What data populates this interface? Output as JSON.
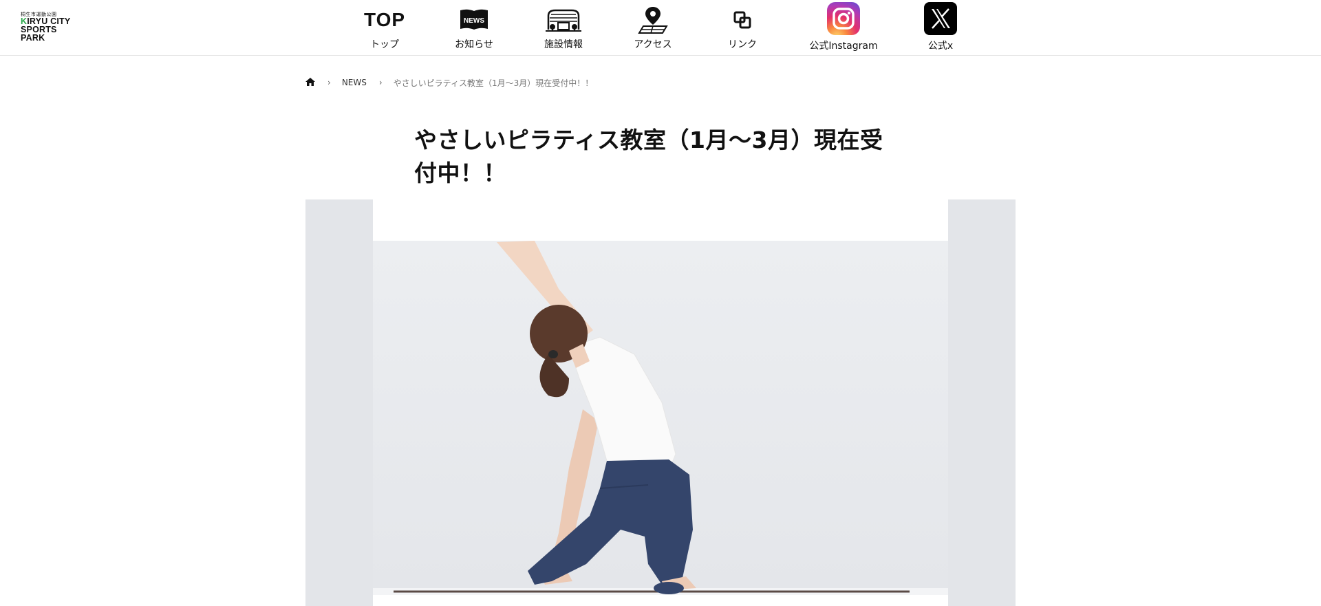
{
  "site": {
    "logo": {
      "small_text": "桐生市運動公園",
      "line1_k": "K",
      "line1_rest": "IRYU CITY",
      "line2": "SPORTS",
      "line3": "PARK"
    }
  },
  "nav": {
    "top": {
      "icon_text": "TOP",
      "label": "トップ"
    },
    "news": {
      "icon_text": "NEWS",
      "label": "お知らせ"
    },
    "facility": {
      "label": "施設情報"
    },
    "access": {
      "label": "アクセス"
    },
    "links": {
      "label": "リンク"
    },
    "instagram": {
      "label": "公式Instagram"
    },
    "x": {
      "label": "公式x"
    }
  },
  "breadcrumb": {
    "section": "NEWS",
    "current": "やさしいピラティス教室（1月〜3月）現在受付中！！"
  },
  "article": {
    "title": "やさしいピラティス教室（1月〜3月）現在受付中！！"
  },
  "colors": {
    "accent_green": "#2aa84a",
    "hero_bg": "#e3e5e9",
    "leggings": "#34456b"
  }
}
